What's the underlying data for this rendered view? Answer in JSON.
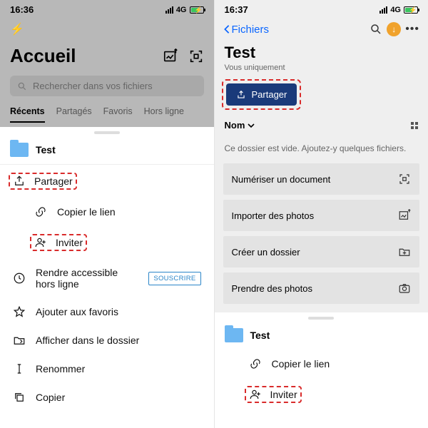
{
  "left": {
    "status": {
      "time": "16:36",
      "net": "4G"
    },
    "title": "Accueil",
    "search_placeholder": "Rechercher dans vos fichiers",
    "tabs": [
      "Récents",
      "Partagés",
      "Favoris",
      "Hors ligne"
    ],
    "folder_name": "Test",
    "menu": {
      "share": "Partager",
      "copy_link": "Copier le lien",
      "invite": "Inviter",
      "offline": "Rendre accessible hors ligne",
      "subscribe": "SOUSCRIRE",
      "favorite": "Ajouter aux favoris",
      "reveal": "Afficher dans le dossier",
      "rename": "Renommer",
      "copy": "Copier"
    }
  },
  "right": {
    "status": {
      "time": "16:37",
      "net": "4G"
    },
    "back": "Fichiers",
    "title": "Test",
    "subtitle": "Vous uniquement",
    "share_btn": "Partager",
    "sort_label": "Nom",
    "empty_msg": "Ce dossier est vide. Ajoutez-y quelques fichiers.",
    "cards": {
      "scan": "Numériser un document",
      "import": "Importer des photos",
      "newfolder": "Créer un dossier",
      "camera": "Prendre des photos"
    },
    "sheet": {
      "folder_name": "Test",
      "copy_link": "Copier le lien",
      "invite": "Inviter"
    }
  }
}
